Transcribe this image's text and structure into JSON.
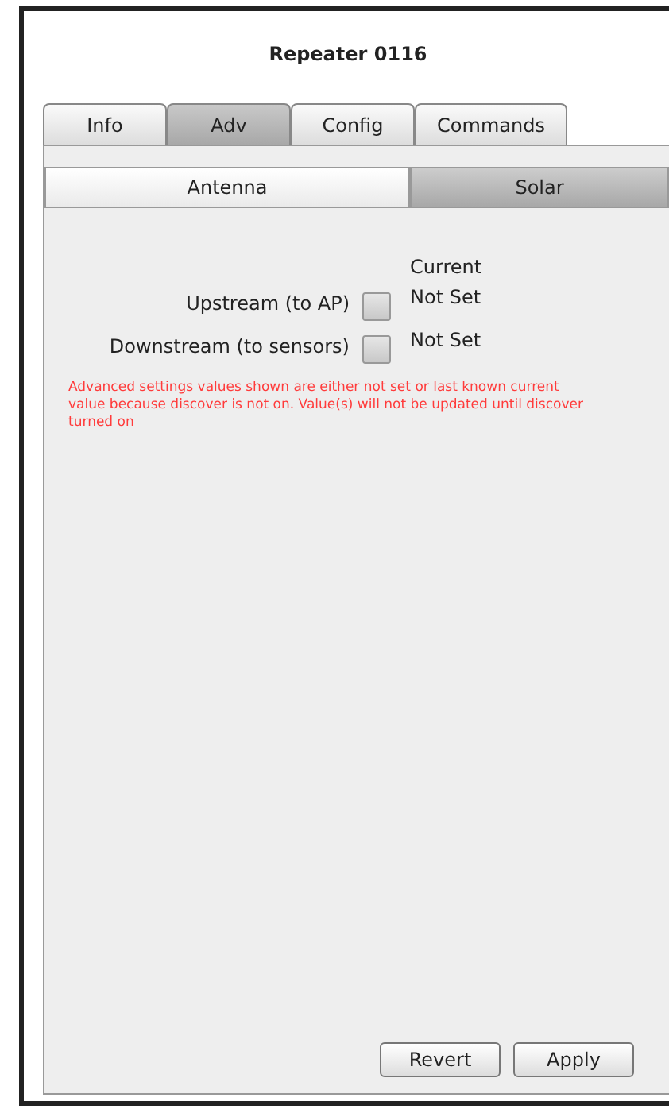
{
  "window": {
    "title": "Repeater 0116"
  },
  "tabs": [
    {
      "label": "Info",
      "selected": false
    },
    {
      "label": "Adv",
      "selected": true
    },
    {
      "label": "Config",
      "selected": false
    },
    {
      "label": "Commands",
      "selected": false
    }
  ],
  "subtabs": [
    {
      "label": "Antenna",
      "selected": true
    },
    {
      "label": "Solar",
      "selected": false
    }
  ],
  "current_header": "Current",
  "settings": [
    {
      "label": "Upstream (to AP)",
      "checked": false,
      "current": "Not Set"
    },
    {
      "label": "Downstream (to sensors)",
      "checked": false,
      "current": "Not Set"
    }
  ],
  "warning": "Advanced settings values shown are either not set or last known current value because discover is not on. Value(s) will not be updated until discover turned on",
  "buttons": [
    "Revert",
    "Apply"
  ]
}
